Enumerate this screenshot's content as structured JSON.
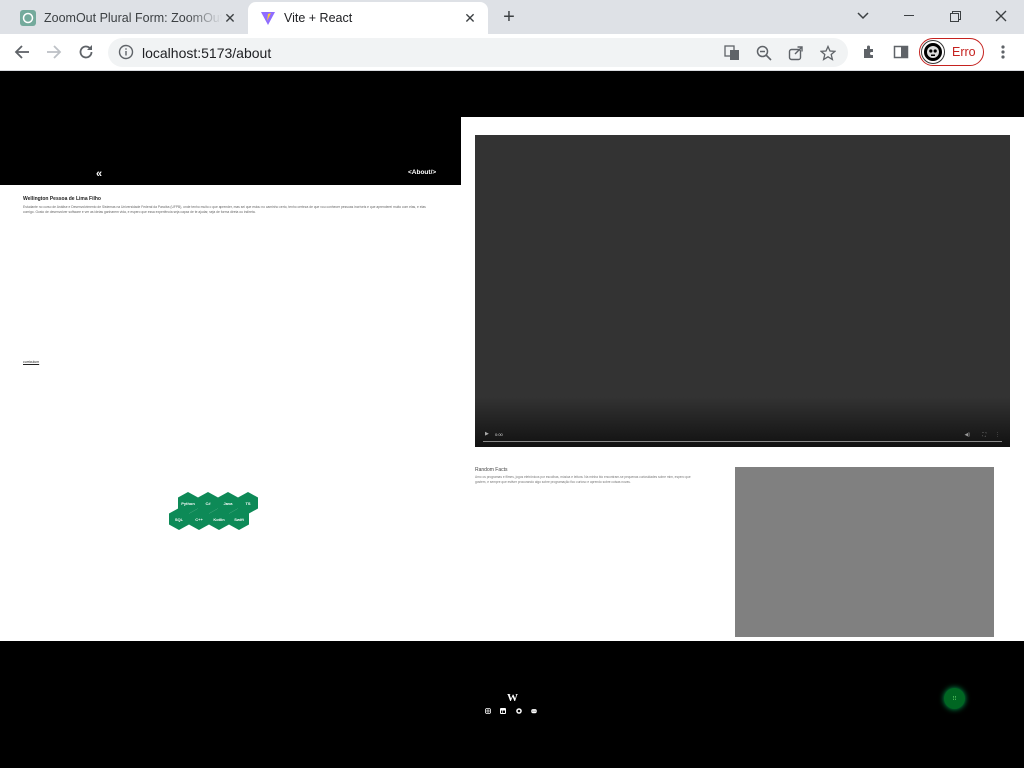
{
  "browser": {
    "tabs": [
      {
        "title": "ZoomOut Plural Form: ZoomOut",
        "active": false,
        "icon": "chatgpt-icon"
      },
      {
        "title": "Vite + React",
        "active": true,
        "icon": "vite-icon"
      }
    ],
    "url": "localhost:5173/about",
    "profile_label": "Erro"
  },
  "page": {
    "header": {
      "back_label": "«",
      "about_tag": "<About/>"
    },
    "about": {
      "name": "Wellington Pessoa de Lima Filho",
      "bio": "Estudante no curso de Análise e Desenvolvimento de Sistemas na Universidade Federal da Paraíba (UFPB), onde tenho muito o que aprender, mas sei que estou no caminho certo, tenho certeza de que vou conhecer pessoas incríveis e que aprenderei muito com elas, e elas comigo. Gosto de desenvolver software e ver as ideias ganharem vida, e espero que essa experiência seja capaz de te ajudar, seja de forma direta ou indireta.",
      "link_label": "curriculum"
    },
    "video": {
      "time": "0:00"
    },
    "random_facts": {
      "title": "Random Facts",
      "text": "Amo os programas e filmes, jogos eletrônicos por escolhas, música e leitura. Na minha bio encontram-se pequenas curiosidades sobre mim, espero que gostem, e sempre que estiver procurando algo sobre programação fico curioso e aprendo sobre coisas novas."
    },
    "skills": [
      "Python",
      "C#",
      "Java",
      "TS",
      "SQL",
      "C++",
      "Kotlin",
      "Swift"
    ],
    "footer": {
      "logo": "W",
      "socials": [
        "instagram-icon",
        "linkedin-icon",
        "github-icon",
        "discord-icon"
      ]
    }
  },
  "colors": {
    "accent_green": "#0d8a57",
    "profile_red": "#c5221f",
    "hero_black": "#000000"
  }
}
